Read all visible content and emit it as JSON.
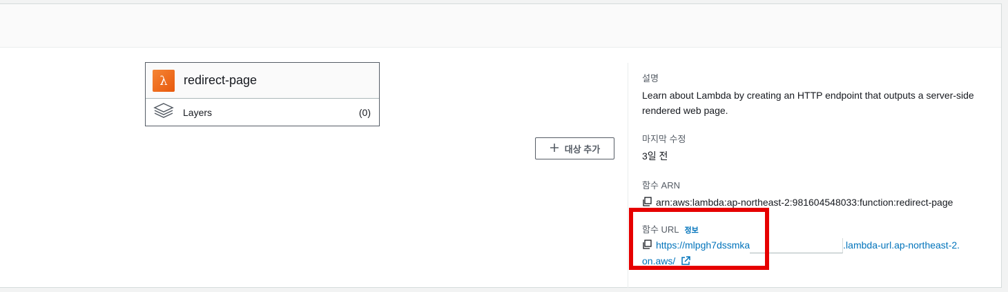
{
  "function_card": {
    "name": "redirect-page",
    "layers_label": "Layers",
    "layers_count": "(0)"
  },
  "add_target_button": {
    "label": "대상 추가"
  },
  "details": {
    "description_label": "설명",
    "description_value": "Learn about Lambda by creating an HTTP endpoint that outputs a server-side rendered web page.",
    "last_modified_label": "마지막 수정",
    "last_modified_value": "3일 전",
    "arn_label": "함수 ARN",
    "arn_value": "arn:aws:lambda:ap-northeast-2:981604548033:function:redirect-page",
    "url_label": "함수 URL",
    "url_info_link": "정보",
    "url_prefix": "https://mlpgh7dssmka",
    "url_suffix": ".lambda-url.ap-northeast-2.",
    "url_tail": "on.aws/"
  },
  "colors": {
    "link": "#0073bb",
    "highlight": "#e60000",
    "lambda_orange": "#f58534"
  },
  "icons": [
    "lambda-icon",
    "layers-icon",
    "plus-icon",
    "copy-icon",
    "external-link-icon"
  ]
}
